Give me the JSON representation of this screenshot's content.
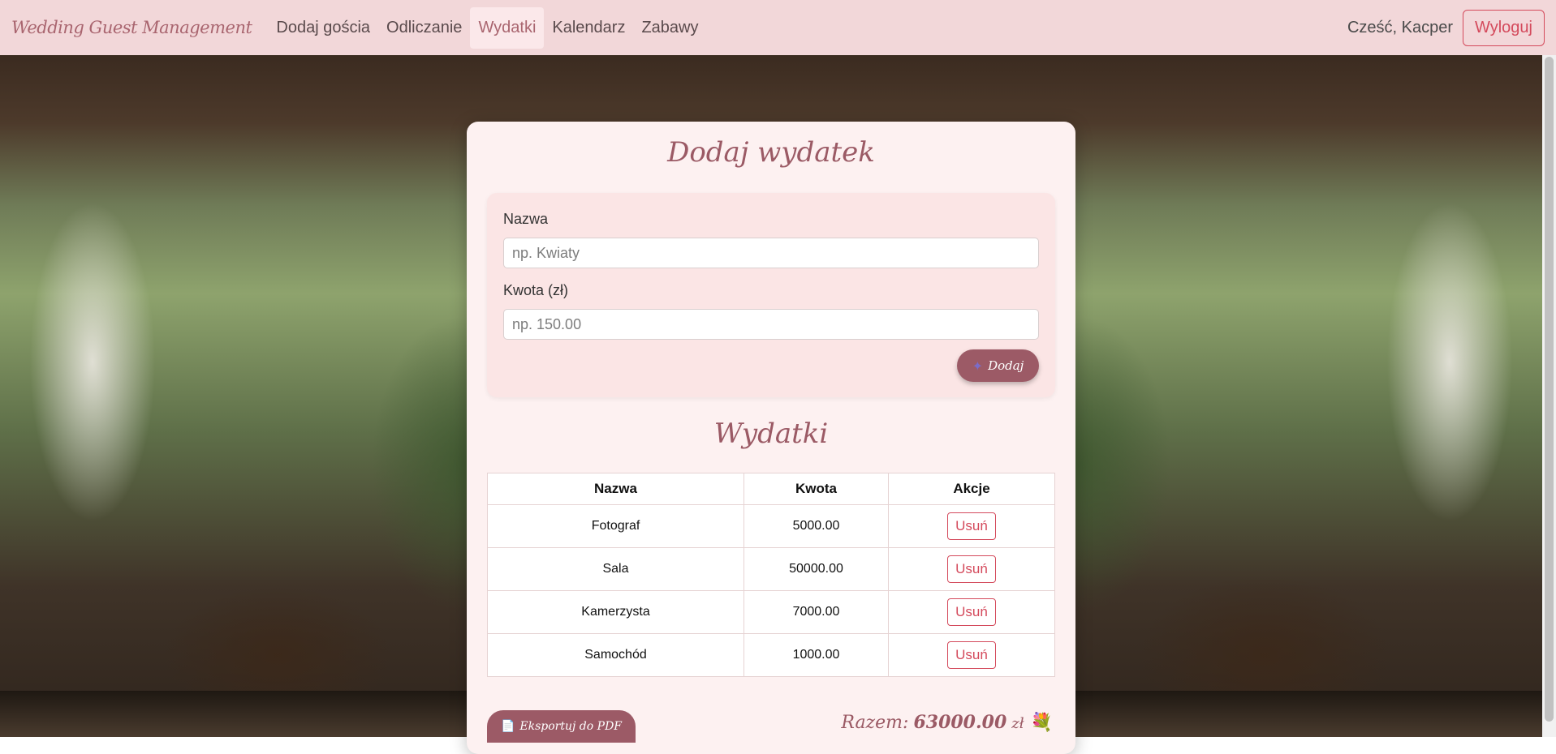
{
  "navbar": {
    "brand": "Wedding Guest Management",
    "links": [
      "Dodaj gościa",
      "Odliczanie",
      "Wydatki",
      "Kalendarz",
      "Zabawy"
    ],
    "active": "Wydatki",
    "greeting": "Cześć, Kacper",
    "logout_label": "Wyloguj"
  },
  "form": {
    "title": "Dodaj wydatek",
    "name_label": "Nazwa",
    "name_placeholder": "np. Kwiaty",
    "amount_label": "Kwota (zł)",
    "amount_placeholder": "np. 150.00",
    "add_icon": "plus-icon",
    "add_label": "Dodaj"
  },
  "expenses": {
    "title": "Wydatki",
    "columns": [
      "Nazwa",
      "Kwota",
      "Akcje"
    ],
    "rows": [
      {
        "name": "Fotograf",
        "amount": "5000.00",
        "action": "Usuń"
      },
      {
        "name": "Sala",
        "amount": "50000.00",
        "action": "Usuń"
      },
      {
        "name": "Kamerzysta",
        "amount": "7000.00",
        "action": "Usuń"
      },
      {
        "name": "Samochód",
        "amount": "1000.00",
        "action": "Usuń"
      }
    ],
    "export_icon": "document-icon",
    "export_label": "Eksportuj do PDF",
    "total_label": "Razem:",
    "total_amount": "63000.00",
    "total_currency": "zł",
    "total_icon": "bouquet-icon"
  },
  "colors": {
    "navbar_bg": "#f2d7d9",
    "accent": "#9c5a66",
    "danger": "#d44a5c",
    "card_bg": "#fdf1f1"
  }
}
